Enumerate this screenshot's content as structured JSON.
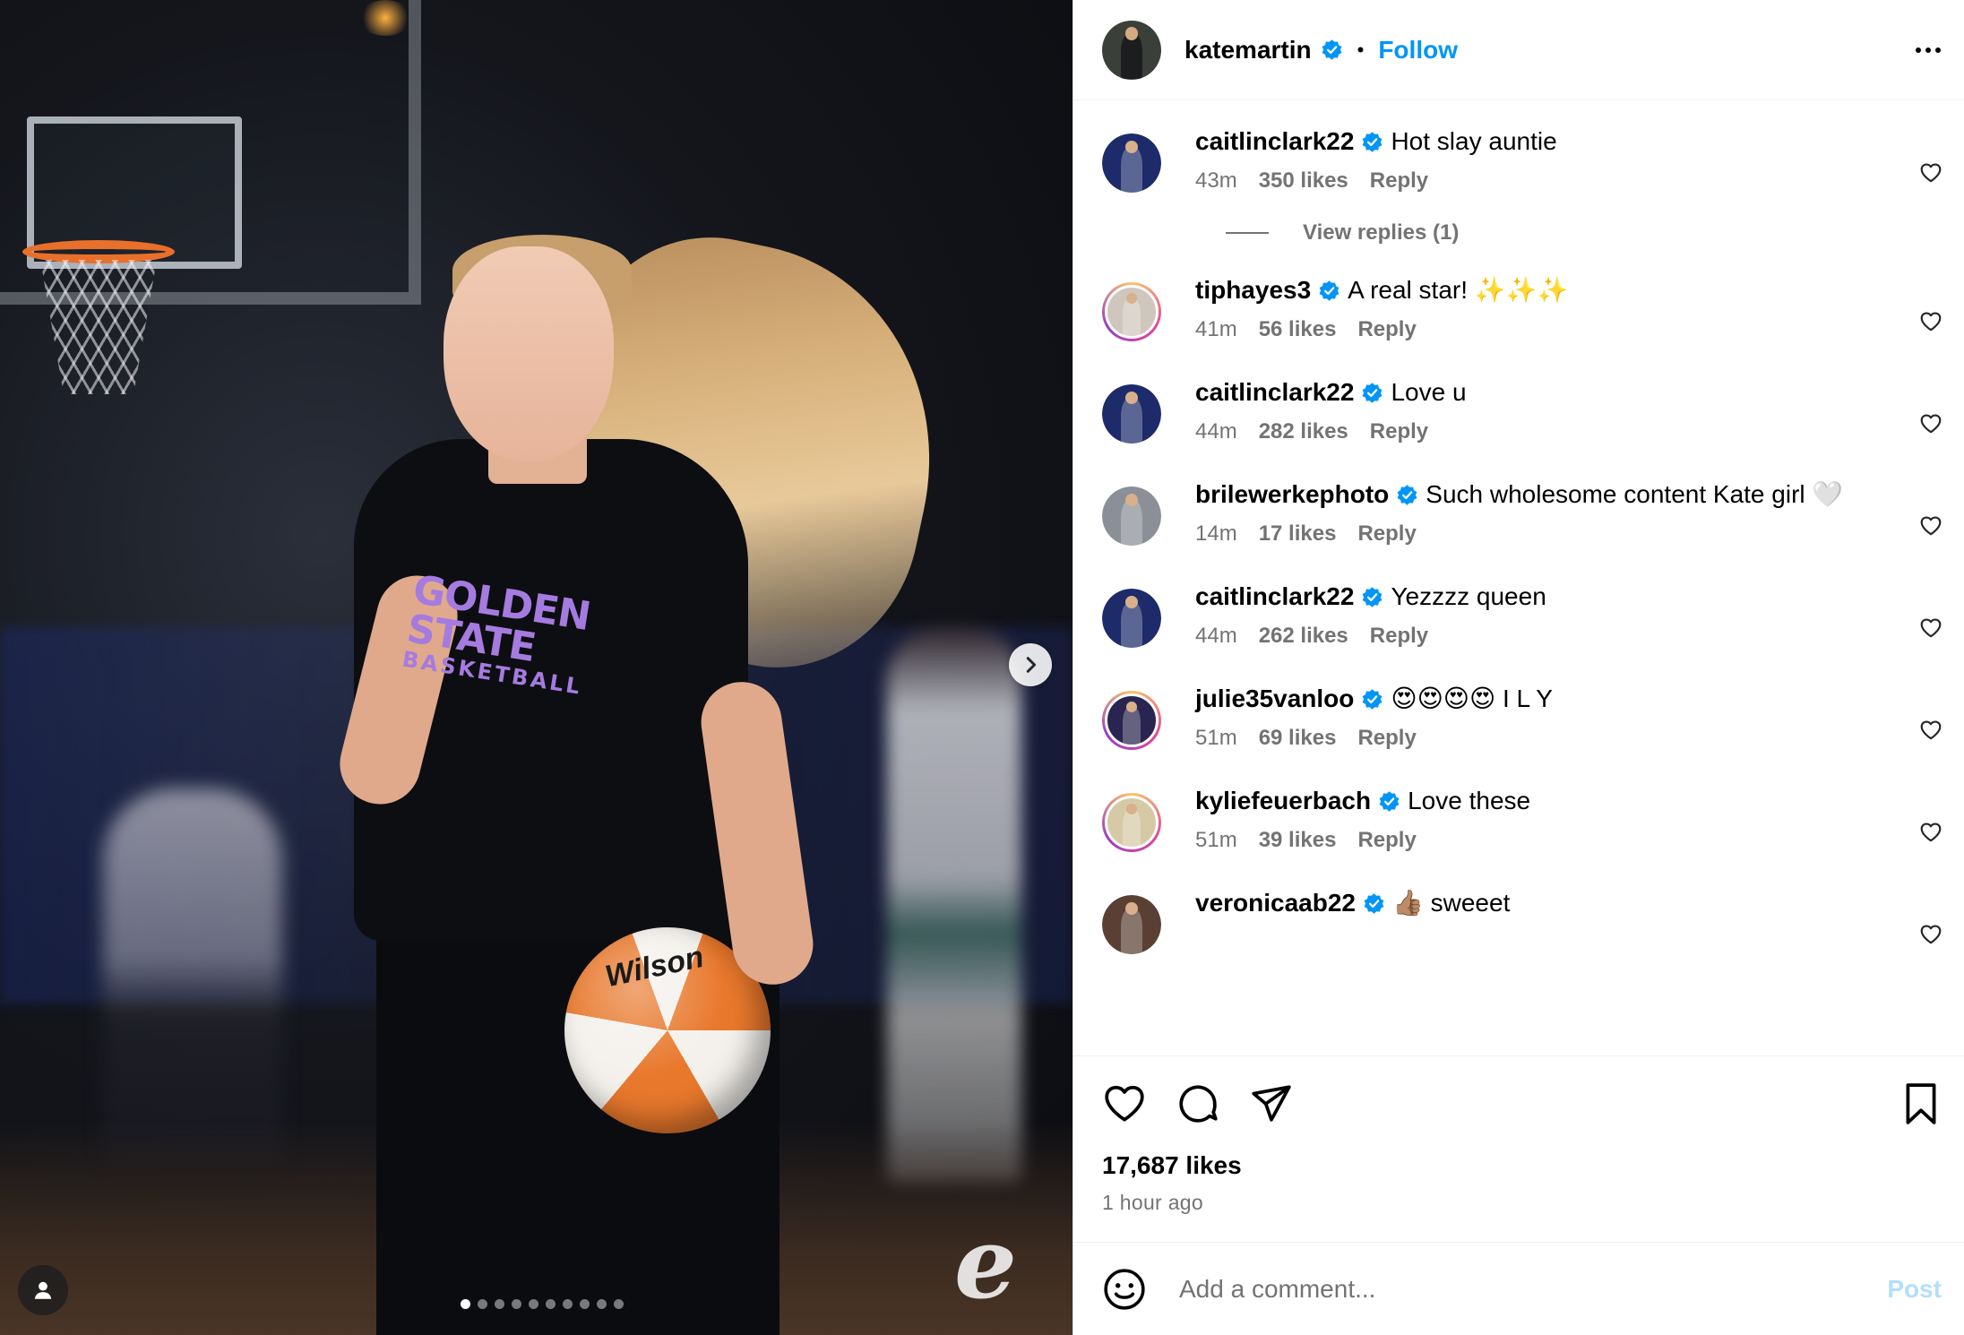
{
  "post": {
    "author": "katemartin",
    "follow_label": "Follow",
    "separator": "•",
    "likes_total": "17,687 likes",
    "time_ago": "1 hour ago"
  },
  "media": {
    "shirt_line1": "GOLDEN STATE",
    "shirt_line2": "BASKETBALL",
    "ball_brand": "Wilson",
    "watermark": "e",
    "carousel_count": 10,
    "carousel_active": 0
  },
  "comments": [
    {
      "user": "caitlinclark22",
      "text": "Hot slay auntie",
      "time": "43m",
      "likes": "350 likes",
      "reply": "Reply",
      "ring": false,
      "avatar_bg": "#1d2b6b"
    },
    {
      "user": "tiphayes3",
      "text": "A real star! ✨✨✨",
      "time": "41m",
      "likes": "56 likes",
      "reply": "Reply",
      "ring": true,
      "avatar_bg": "#cfc7bd"
    },
    {
      "user": "caitlinclark22",
      "text": "Love u",
      "time": "44m",
      "likes": "282 likes",
      "reply": "Reply",
      "ring": false,
      "avatar_bg": "#1d2b6b"
    },
    {
      "user": "brilewerkephoto",
      "text": "Such wholesome content Kate girl 🤍",
      "time": "14m",
      "likes": "17 likes",
      "reply": "Reply",
      "ring": false,
      "avatar_bg": "#8a8f98"
    },
    {
      "user": "caitlinclark22",
      "text": "Yezzzz queen",
      "time": "44m",
      "likes": "262 likes",
      "reply": "Reply",
      "ring": false,
      "avatar_bg": "#1d2b6b"
    },
    {
      "user": "julie35vanloo",
      "text": "😍😍😍😍 I L Y",
      "time": "51m",
      "likes": "69 likes",
      "reply": "Reply",
      "ring": true,
      "avatar_bg": "#2a2450"
    },
    {
      "user": "kyliefeuerbach",
      "text": "Love these",
      "time": "51m",
      "likes": "39 likes",
      "reply": "Reply",
      "ring": true,
      "avatar_bg": "#d6c9a6"
    },
    {
      "user": "veronicaab22",
      "text": "👍🏽 sweeet",
      "time": "",
      "likes": "",
      "reply": "",
      "ring": false,
      "avatar_bg": "#5a4034"
    }
  ],
  "view_replies": "View replies (1)",
  "add_comment": {
    "placeholder": "Add a comment...",
    "post_label": "Post"
  },
  "colors": {
    "accent": "#0095f6",
    "post_disabled": "#b2dffc",
    "meta_gray": "#737373",
    "verified": "#0095f6"
  },
  "icons": [
    "heart-icon",
    "comment-icon",
    "share-icon",
    "bookmark-icon",
    "emoji-icon",
    "more-icon",
    "verified-badge-icon",
    "chevron-right-icon",
    "user-tag-icon"
  ]
}
